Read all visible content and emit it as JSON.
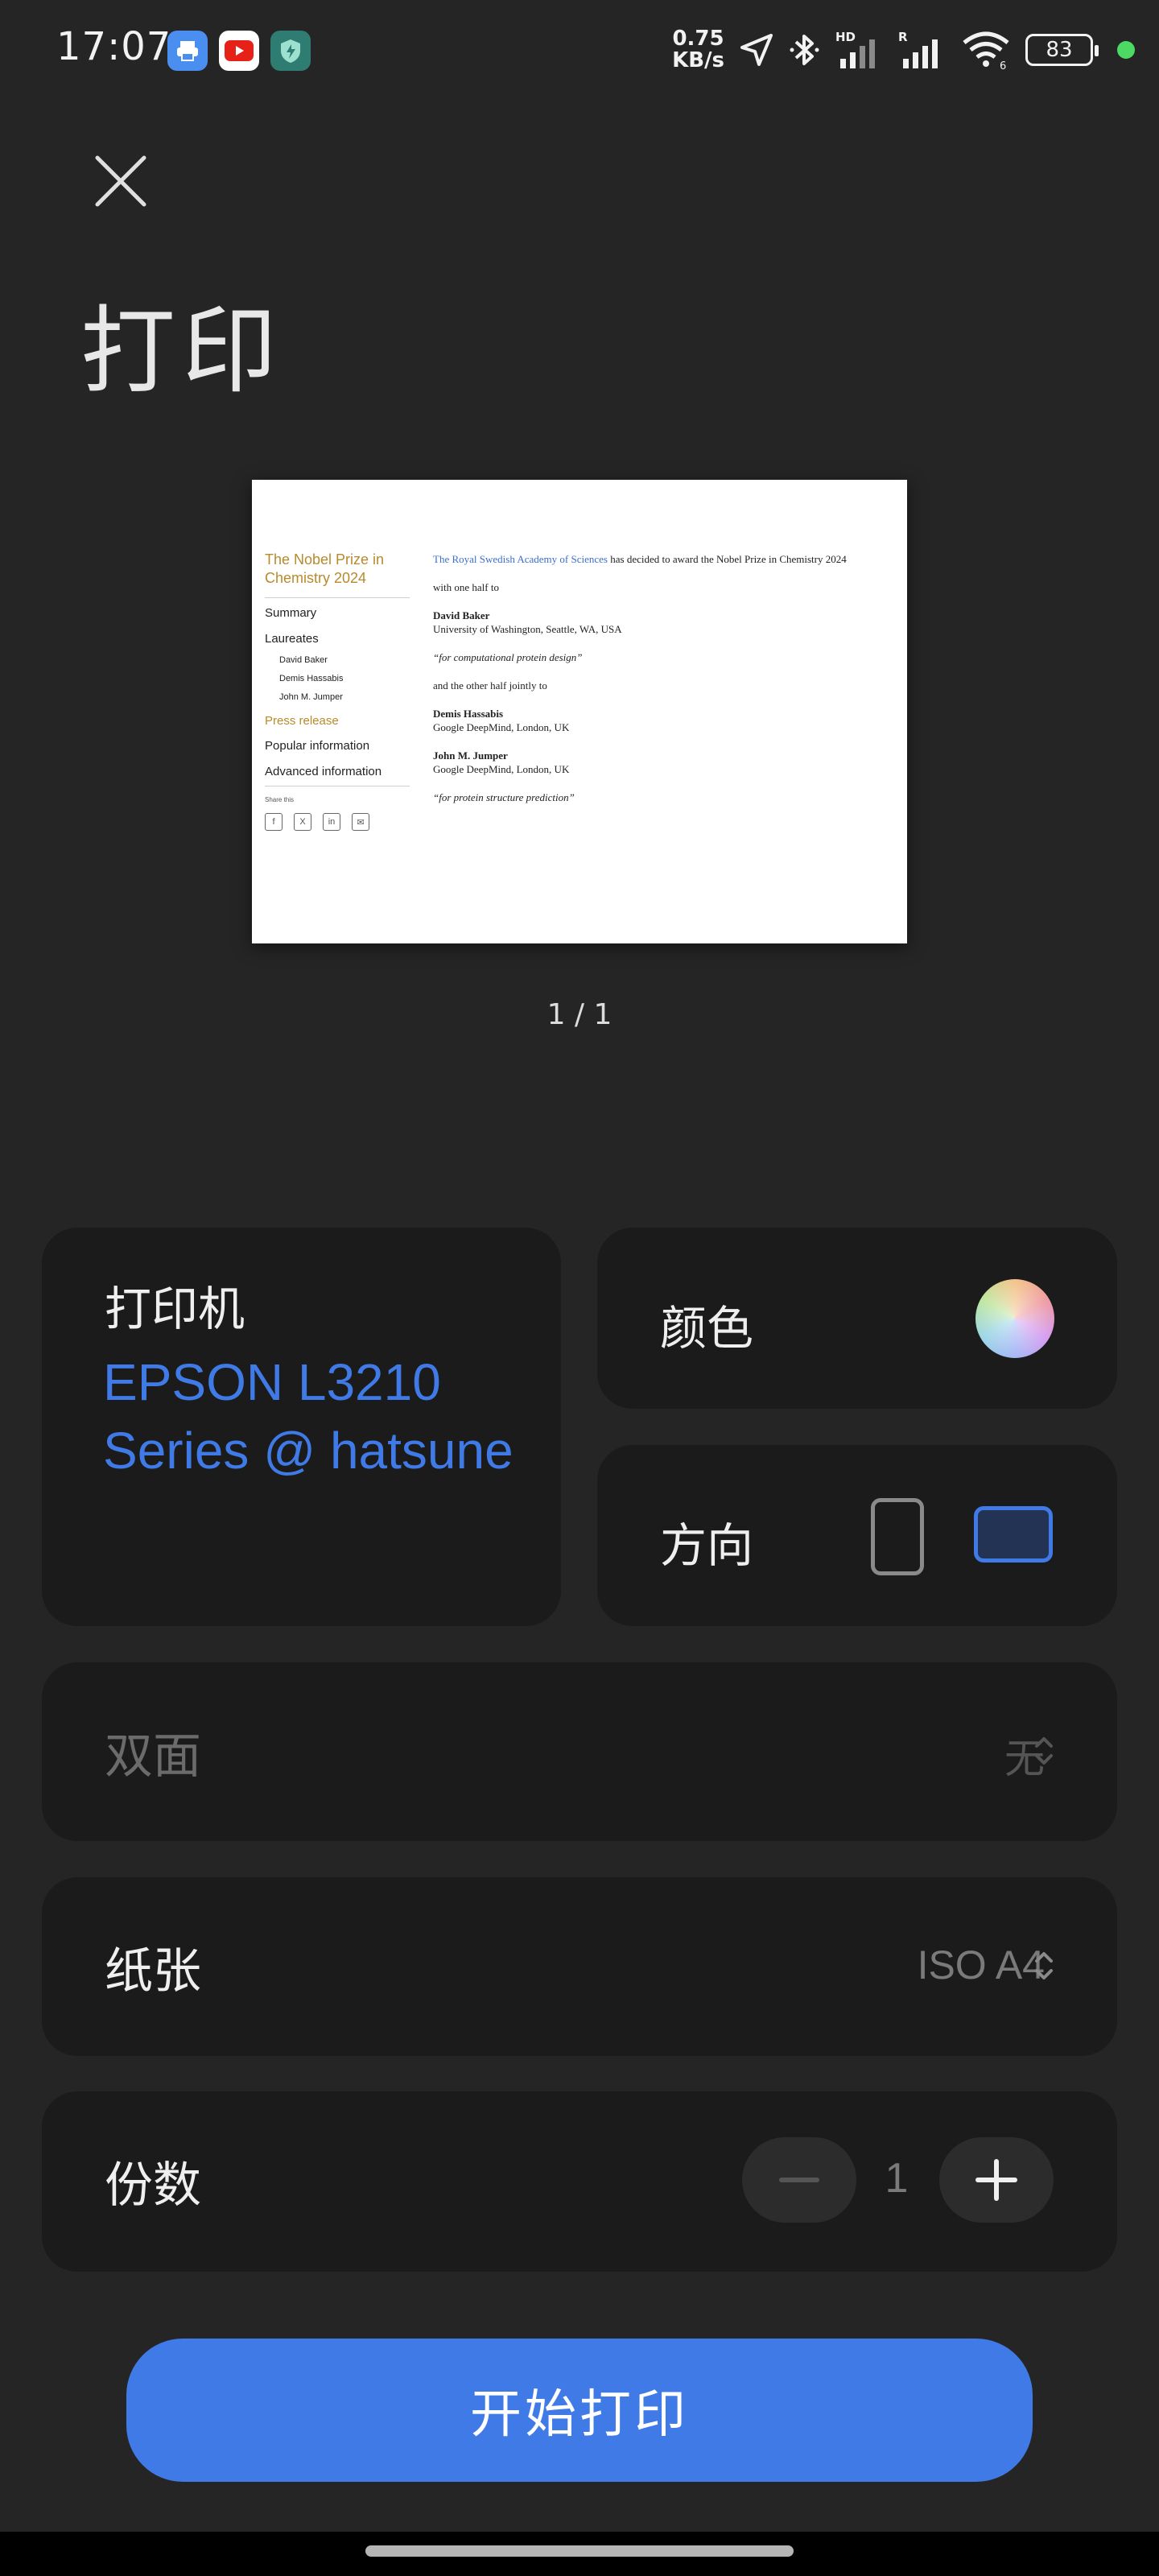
{
  "status_bar": {
    "time": "17:07",
    "net_speed_value": "0.75",
    "net_speed_unit": "KB/s",
    "battery": "83",
    "icons": [
      "print-app-icon",
      "youtube-icon",
      "shield-app-icon",
      "location-icon",
      "bluetooth-icon",
      "signal-hd-icon",
      "signal-r-icon",
      "wifi-icon"
    ]
  },
  "header": {
    "title": "打印"
  },
  "preview": {
    "sidebar": {
      "title": "The Nobel Prize in Chemistry 2024",
      "nav": [
        "Summary",
        "Laureates"
      ],
      "laureates": [
        "David Baker",
        "Demis Hassabis",
        "John M. Jumper"
      ],
      "press": "Press release",
      "more_nav": [
        "Popular information",
        "Advanced information"
      ],
      "share": "Share this"
    },
    "main": {
      "academy": "The Royal Swedish Academy of Sciences",
      "intro_rest": " has decided to award the Nobel Prize in Chemistry 2024",
      "half_one": "with one half to",
      "l1_name": "David Baker",
      "l1_affil": "University of Washington, Seattle, WA, USA",
      "l1_citation": "“for computational protein design”",
      "half_two": "and the other half jointly to",
      "l2_name": "Demis Hassabis",
      "l2_affil": "Google DeepMind, London, UK",
      "l3_name": "John M. Jumper",
      "l3_affil": "Google DeepMind, London, UK",
      "l23_citation": "“for protein structure prediction”"
    },
    "page_count": "1 / 1"
  },
  "settings": {
    "printer_label": "打印机",
    "printer_name": "EPSON L3210 Series @ hatsune",
    "color_label": "颜色",
    "orientation_label": "方向",
    "orientation_selected": "landscape",
    "duplex_label": "双面",
    "duplex_value": "无",
    "paper_label": "纸张",
    "paper_value": "ISO A4",
    "copies_label": "份数",
    "copies_value": "1"
  },
  "print_button": "开始打印",
  "colors": {
    "accent": "#3f7ae6",
    "background": "#252525",
    "card": "#1b1b1b",
    "gold": "#b88a2c"
  }
}
